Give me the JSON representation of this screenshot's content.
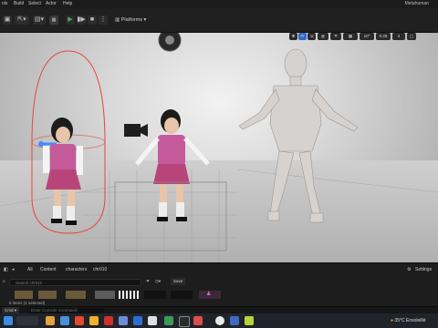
{
  "menubar": {
    "items": [
      "ols",
      "Build",
      "Select",
      "Actor",
      "Help"
    ],
    "window_title": "Metahuman"
  },
  "toolbar": {
    "platforms_label": "Platforms",
    "icons": [
      "save-icon",
      "select-mode-icon",
      "content-icon",
      "blueprint-icon",
      "cinematics-icon",
      "play-icon",
      "step-icon",
      "stop-icon",
      "more-icon"
    ]
  },
  "viewport": {
    "controls": [
      "10°",
      "0.25",
      "4"
    ],
    "characters": [
      "child-character-left",
      "child-character-center",
      "mannequin-character"
    ]
  },
  "content_browser": {
    "breadcrumb": [
      "All",
      "Content",
      "characters",
      "chr010"
    ],
    "settings_label": "Settings",
    "search_placeholder": "Search chr010",
    "filter_label": "Save",
    "items_count": "8 items (1 selected)"
  },
  "statusbar": {
    "cmd_label": "Cmd",
    "console_placeholder": "Enter Console Command"
  },
  "taskbar": {
    "weather": "35°C  Ensoleillé"
  }
}
